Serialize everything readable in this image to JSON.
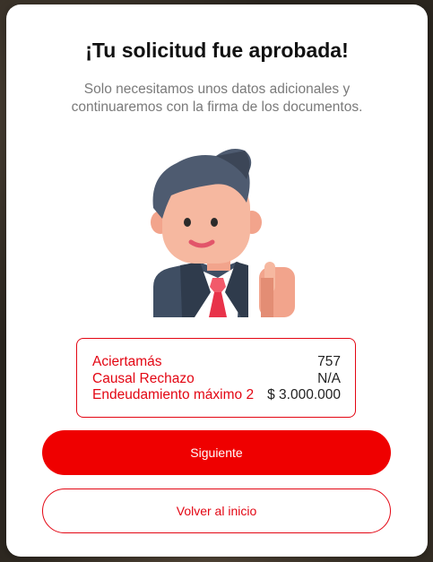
{
  "modal": {
    "title": "¡Tu solicitud fue aprobada!",
    "subtitle": "Solo necesitamos unos datos adicionales y continuaremos con la firma de los documentos.",
    "illustration_icon": "businessman-thumbs-up-icon"
  },
  "summary": {
    "rows": [
      {
        "label": "Aciertamás",
        "value": "757"
      },
      {
        "label": "Causal Rechazo",
        "value": "N/A"
      },
      {
        "label": "Endeudamiento máximo 2",
        "value": "$ 3.000.000"
      }
    ]
  },
  "actions": {
    "next_label": "Siguiente",
    "back_label": "Volver al inicio"
  },
  "colors": {
    "accent": "#ef0000",
    "label_red": "#e30613",
    "subtitle_gray": "#7a7a7a"
  }
}
